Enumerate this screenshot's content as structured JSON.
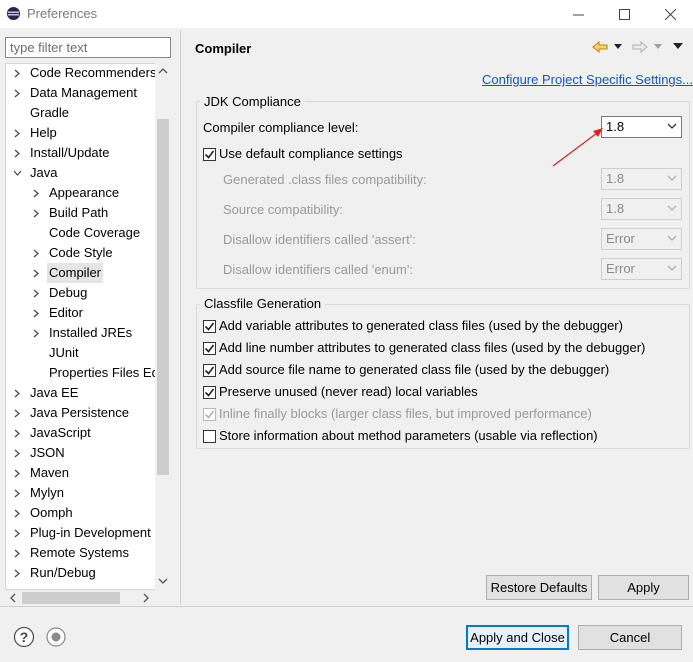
{
  "window": {
    "title": "Preferences",
    "icon": "eclipse-icon"
  },
  "filter": {
    "placeholder": "type filter text",
    "value": ""
  },
  "tree": {
    "items": [
      {
        "label": "Code Recommenders",
        "level": 0,
        "expanded": false
      },
      {
        "label": "Data Management",
        "level": 0,
        "expanded": false
      },
      {
        "label": "Gradle",
        "level": 0,
        "leaf": true
      },
      {
        "label": "Help",
        "level": 0,
        "expanded": false
      },
      {
        "label": "Install/Update",
        "level": 0,
        "expanded": false
      },
      {
        "label": "Java",
        "level": 0,
        "expanded": true
      },
      {
        "label": "Appearance",
        "level": 1,
        "expanded": false
      },
      {
        "label": "Build Path",
        "level": 1,
        "expanded": false
      },
      {
        "label": "Code Coverage",
        "level": 1,
        "leaf": true
      },
      {
        "label": "Code Style",
        "level": 1,
        "expanded": false
      },
      {
        "label": "Compiler",
        "level": 1,
        "expanded": false,
        "selected": true
      },
      {
        "label": "Debug",
        "level": 1,
        "expanded": false
      },
      {
        "label": "Editor",
        "level": 1,
        "expanded": false
      },
      {
        "label": "Installed JREs",
        "level": 1,
        "expanded": false
      },
      {
        "label": "JUnit",
        "level": 1,
        "leaf": true
      },
      {
        "label": "Properties Files Ed",
        "level": 1,
        "leaf": true
      },
      {
        "label": "Java EE",
        "level": 0,
        "expanded": false
      },
      {
        "label": "Java Persistence",
        "level": 0,
        "expanded": false
      },
      {
        "label": "JavaScript",
        "level": 0,
        "expanded": false
      },
      {
        "label": "JSON",
        "level": 0,
        "expanded": false
      },
      {
        "label": "Maven",
        "level": 0,
        "expanded": false
      },
      {
        "label": "Mylyn",
        "level": 0,
        "expanded": false
      },
      {
        "label": "Oomph",
        "level": 0,
        "expanded": false
      },
      {
        "label": "Plug-in Development",
        "level": 0,
        "expanded": false
      },
      {
        "label": "Remote Systems",
        "level": 0,
        "expanded": false
      },
      {
        "label": "Run/Debug",
        "level": 0,
        "expanded": false
      }
    ]
  },
  "page": {
    "title": "Compiler",
    "configure_link": "Configure Project Specific Settings...",
    "jdk": {
      "group_title": "JDK Compliance",
      "compliance_label": "Compiler compliance level:",
      "compliance_value": "1.8",
      "use_default_label": "Use default compliance settings",
      "use_default_checked": true,
      "rows": [
        {
          "label": "Generated .class files compatibility:",
          "value": "1.8"
        },
        {
          "label": "Source compatibility:",
          "value": "1.8"
        },
        {
          "label": "Disallow identifiers called 'assert':",
          "value": "Error"
        },
        {
          "label": "Disallow identifiers called 'enum':",
          "value": "Error"
        }
      ]
    },
    "classfile": {
      "group_title": "Classfile Generation",
      "options": [
        {
          "label": "Add variable attributes to generated class files (used by the debugger)",
          "checked": true,
          "enabled": true
        },
        {
          "label": "Add line number attributes to generated class files (used by the debugger)",
          "checked": true,
          "enabled": true
        },
        {
          "label": "Add source file name to generated class file (used by the debugger)",
          "checked": true,
          "enabled": true
        },
        {
          "label": "Preserve unused (never read) local variables",
          "checked": true,
          "enabled": true
        },
        {
          "label": "Inline finally blocks (larger class files, but improved performance)",
          "checked": true,
          "enabled": false
        },
        {
          "label": "Store information about method parameters (usable via reflection)",
          "checked": false,
          "enabled": true
        }
      ]
    },
    "restore_defaults": "Restore Defaults",
    "apply": "Apply"
  },
  "footer": {
    "apply_and_close": "Apply and Close",
    "cancel": "Cancel"
  },
  "colors": {
    "link": "#0b58c3",
    "annotation_arrow": "#e02020",
    "default_button_border": "#0078d7"
  }
}
